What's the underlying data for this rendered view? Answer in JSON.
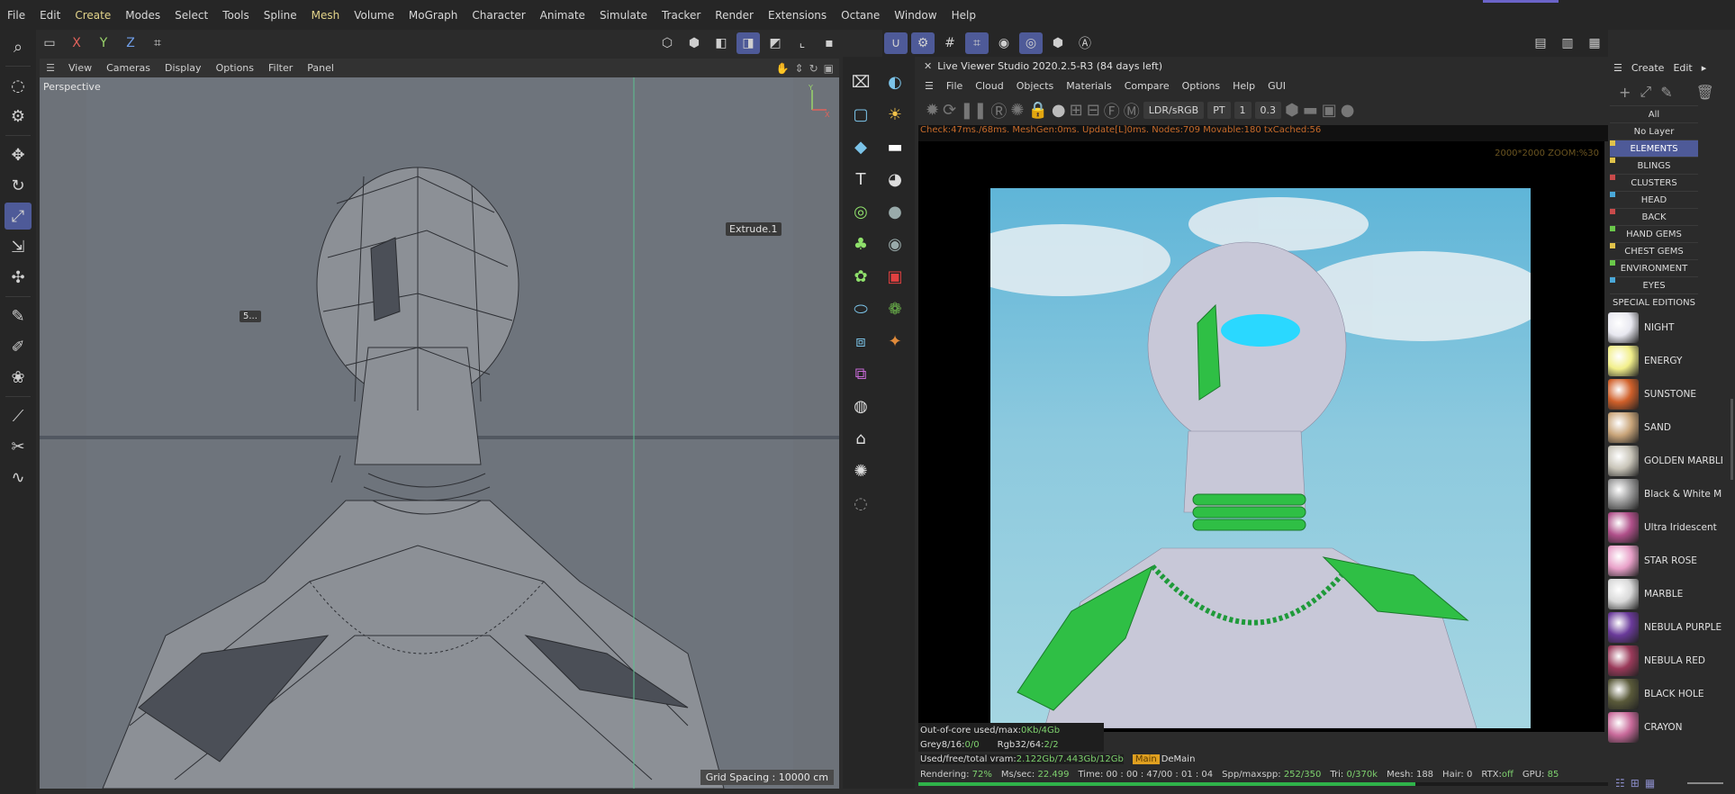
{
  "menubar": {
    "items": [
      "File",
      "Edit",
      "Create",
      "Modes",
      "Select",
      "Tools",
      "Spline",
      "Mesh",
      "Volume",
      "MoGraph",
      "Character",
      "Animate",
      "Simulate",
      "Tracker",
      "Render",
      "Extensions",
      "Octane",
      "Window",
      "Help"
    ],
    "highlighted": [
      "Create",
      "Mesh"
    ]
  },
  "vptop": {
    "x": "X",
    "y": "Y",
    "z": "Z"
  },
  "vpmenu": {
    "items": [
      "View",
      "Cameras",
      "Display",
      "Options",
      "Filter",
      "Panel"
    ]
  },
  "viewport": {
    "label": "Perspective",
    "tag": "Extrude.1",
    "tag2": "5...",
    "grid": "Grid Spacing : 10000 cm",
    "axis_y": "Y",
    "axis_x": "X"
  },
  "liveviewer": {
    "title": "Live Viewer Studio 2020.2.5-R3 (84 days left)",
    "menu": [
      "File",
      "Cloud",
      "Objects",
      "Materials",
      "Compare",
      "Options",
      "Help",
      "GUI"
    ],
    "colorspace": "LDR/sRGB",
    "kernel": "PT",
    "frame": "1",
    "exposure": "0.3",
    "stats": "Check:47ms./68ms. MeshGen:0ms. Update[L]0ms. Nodes:709 Movable:180 txCached:56",
    "zoominfo": "2000*2000 ZOOM:%30",
    "info": {
      "ooc_label": "Out-of-core used/max:",
      "ooc_value": "0Kb/4Gb",
      "grey_label": "Grey8/16:",
      "grey_value": "0/0",
      "rgb_label": "Rgb32/64:",
      "rgb_value": "2/2",
      "vram_label": "Used/free/total vram:",
      "vram_value": "2.122Gb/7.443Gb/12Gb",
      "tab_main": "Main",
      "tab_demain": "DeMain"
    },
    "status": {
      "rendering_label": "Rendering:",
      "rendering_value": "72%",
      "mssec_label": "Ms/sec:",
      "mssec_value": "22.499",
      "time_label": "Time:",
      "time_value": "00 : 00 : 47/00 : 01 : 04",
      "spp_label": "Spp/maxspp:",
      "spp_value": "252/350",
      "tri_label": "Tri:",
      "tri_value": "0/370k",
      "mesh_label": "Mesh:",
      "mesh_value": "188",
      "hair_label": "Hair:",
      "hair_value": "0",
      "rtx_label": "RTX:",
      "rtx_value": "off",
      "gpu_label": "GPU:",
      "gpu_value": "85"
    },
    "progress": 0.72
  },
  "rightpanel": {
    "create": "Create",
    "edit": "Edit",
    "layers": [
      {
        "name": "All",
        "color": ""
      },
      {
        "name": "No Layer",
        "color": ""
      },
      {
        "name": "ELEMENTS",
        "color": "#e0c24a"
      },
      {
        "name": "BLINGS",
        "color": "#e0c24a"
      },
      {
        "name": "CLUSTERS",
        "color": "#c84a4a"
      },
      {
        "name": "HEAD",
        "color": "#4aa8d8"
      },
      {
        "name": "BACK",
        "color": "#c84a4a"
      },
      {
        "name": "HAND GEMS",
        "color": "#6ac84a"
      },
      {
        "name": "CHEST GEMS",
        "color": "#e0c24a"
      },
      {
        "name": "ENVIRONMENT",
        "color": "#6ac84a"
      },
      {
        "name": "EYES",
        "color": "#4aa8d8"
      },
      {
        "name": "SPECIAL EDITIONS",
        "color": ""
      }
    ],
    "materials": [
      {
        "name": "NIGHT",
        "color": "#e8e8f0"
      },
      {
        "name": "ENERGY",
        "color": "#f2ef8a"
      },
      {
        "name": "SUNSTONE",
        "color": "#d0602a"
      },
      {
        "name": "SAND",
        "color": "#c9a57a"
      },
      {
        "name": "GOLDEN MARBLE",
        "color": "#c8c4b8"
      },
      {
        "name": "Black & White M",
        "color": "#9a9a9a"
      },
      {
        "name": "Ultra Iridescent",
        "color": "#b0508a"
      },
      {
        "name": "STAR ROSE",
        "color": "#e8a0c8"
      },
      {
        "name": "MARBLE",
        "color": "#d8d8d8"
      },
      {
        "name": "NEBULA PURPLE",
        "color": "#6a3a9a"
      },
      {
        "name": "NEBULA RED",
        "color": "#9a3a5a"
      },
      {
        "name": "BLACK HOLE",
        "color": "#5a5a3a"
      },
      {
        "name": "CRAYON",
        "color": "#c86a9a"
      }
    ]
  }
}
